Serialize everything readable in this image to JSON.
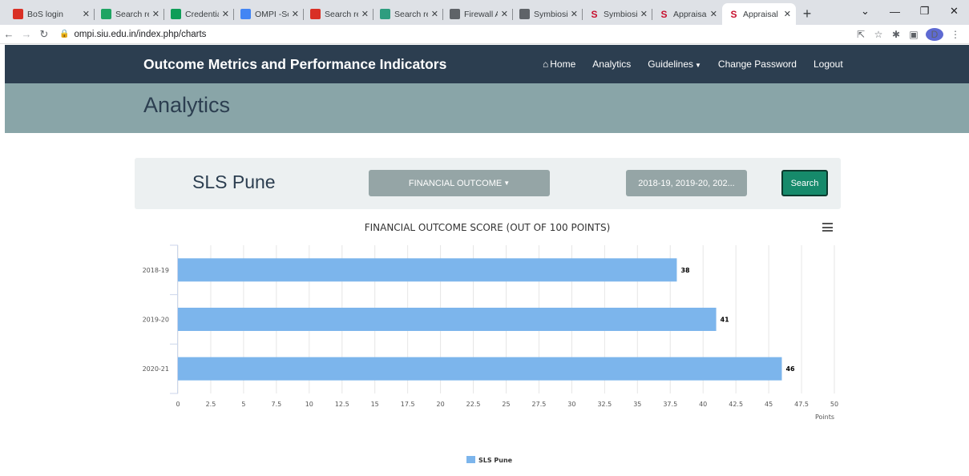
{
  "browser": {
    "tabs": [
      {
        "title": "BoS login",
        "favicon": "gmail-icon",
        "color": "#d93025"
      },
      {
        "title": "Search res",
        "favicon": "drive-icon",
        "color": "#1fa463"
      },
      {
        "title": "Credentiali",
        "favicon": "sheets-icon",
        "color": "#0f9d58"
      },
      {
        "title": "OMPI -Scr",
        "favicon": "docs-icon",
        "color": "#4285f4"
      },
      {
        "title": "Search res",
        "favicon": "gmail-icon",
        "color": "#d93025"
      },
      {
        "title": "Search res",
        "favicon": "edge-icon",
        "color": "#2e9d7f"
      },
      {
        "title": "Firewall Au",
        "favicon": "globe-icon",
        "color": "#5f6368"
      },
      {
        "title": "Symbiosis",
        "favicon": "globe-icon",
        "color": "#5f6368"
      },
      {
        "title": "Symbiosis",
        "favicon": "symbiosis-icon",
        "color": "#c8102e"
      },
      {
        "title": "Appraisal",
        "favicon": "symbiosis-icon",
        "color": "#c8102e"
      },
      {
        "title": "Appraisal",
        "favicon": "symbiosis-icon",
        "color": "#c8102e",
        "active": true
      }
    ],
    "url": "ompi.siu.edu.in/index.php/charts",
    "profile_initial": "D"
  },
  "header": {
    "brand": "Outcome Metrics and Performance Indicators",
    "nav": {
      "home": "Home",
      "analytics": "Analytics",
      "guidelines": "Guidelines",
      "change_password": "Change Password",
      "logout": "Logout"
    }
  },
  "page": {
    "title": "Analytics"
  },
  "filters": {
    "unit": "SLS Pune",
    "outcome": "FINANCIAL OUTCOME",
    "years": "2018-19, 2019-20, 202...",
    "search": "Search"
  },
  "chart_data": {
    "type": "bar",
    "orientation": "horizontal",
    "title": "FINANCIAL OUTCOME SCORE (OUT OF 100 POINTS)",
    "categories": [
      "2018-19",
      "2019-20",
      "2020-21"
    ],
    "series": [
      {
        "name": "SLS Pune",
        "values": [
          38,
          41,
          46
        ],
        "color": "#7cb5ec"
      }
    ],
    "xlabel": "Points",
    "xlim": [
      0,
      50
    ],
    "xticks": [
      "0",
      "2.5",
      "5",
      "7.5",
      "10",
      "12.5",
      "15",
      "17.5",
      "20",
      "22.5",
      "25",
      "27.5",
      "30",
      "32.5",
      "35",
      "37.5",
      "40",
      "42.5",
      "45",
      "47.5",
      "50"
    ],
    "grid": true,
    "legend": "bottom-center"
  }
}
